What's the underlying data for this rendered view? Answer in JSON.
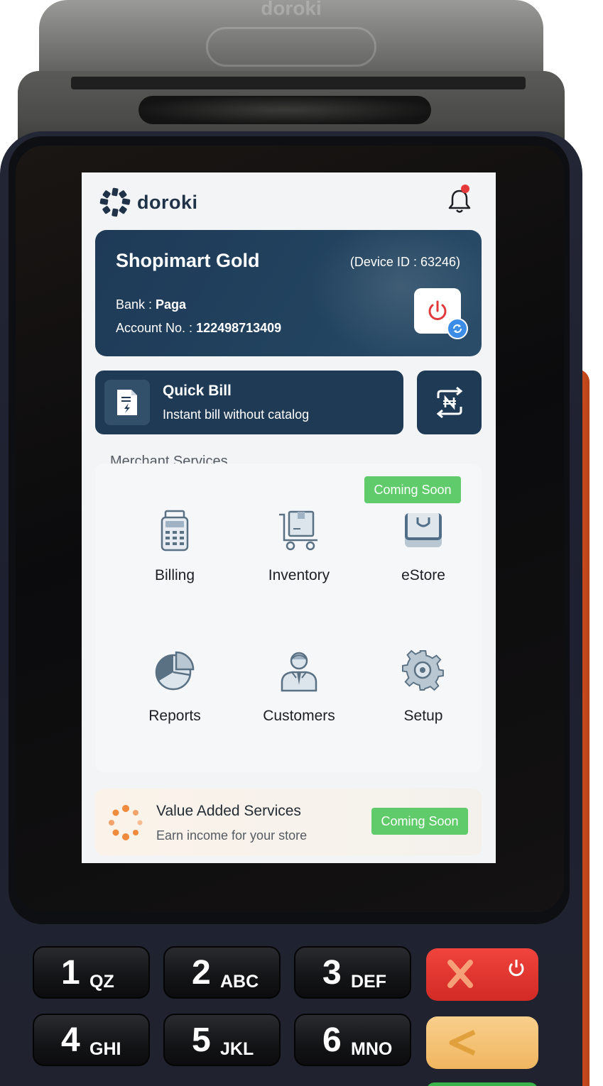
{
  "device": {
    "brand_engraving": "doroki"
  },
  "header": {
    "logo_text": "doroki",
    "notifications_icon": "bell-icon"
  },
  "account": {
    "store_name": "Shopimart Gold",
    "device_id_text": "(Device ID : 63246)",
    "bank_label": "Bank : ",
    "bank_value": "Paga",
    "account_label": "Account No. : ",
    "account_value": "122498713409",
    "power_icon": "power-icon",
    "sync_icon": "sync-icon"
  },
  "quick_bill": {
    "title": "Quick Bill",
    "subtitle": "Instant bill without catalog",
    "icon": "bill-document-icon"
  },
  "currency_exchange": {
    "icon": "naira-exchange-icon"
  },
  "merchant_services": {
    "title": "Merchant Services",
    "items": [
      {
        "label": "Billing",
        "icon": "pos-terminal-icon"
      },
      {
        "label": "Inventory",
        "icon": "cart-box-icon"
      },
      {
        "label": "eStore",
        "icon": "store-bag-icon",
        "badge": "Coming Soon"
      },
      {
        "label": "Reports",
        "icon": "pie-chart-icon"
      },
      {
        "label": "Customers",
        "icon": "person-icon"
      },
      {
        "label": "Setup",
        "icon": "gear-icon"
      }
    ]
  },
  "value_added": {
    "title": "Value Added Services",
    "subtitle": "Earn income for your store",
    "badge": "Coming Soon",
    "icon": "loading-dots-icon"
  },
  "keypad": {
    "keys": [
      {
        "num": "1",
        "alpha": "QZ"
      },
      {
        "num": "2",
        "alpha": "ABC"
      },
      {
        "num": "3",
        "alpha": "DEF"
      },
      {
        "num": "4",
        "alpha": "GHI"
      },
      {
        "num": "5",
        "alpha": "JKL"
      },
      {
        "num": "6",
        "alpha": "MNO"
      }
    ],
    "cancel_icon": "cancel-x-icon",
    "back_icon": "backspace-arrow-icon"
  },
  "colors": {
    "card_navy": "#1f3a55",
    "badge_green": "#5fcb6a",
    "alert_red": "#e63a3a",
    "accent_orange": "#f08a3c"
  }
}
